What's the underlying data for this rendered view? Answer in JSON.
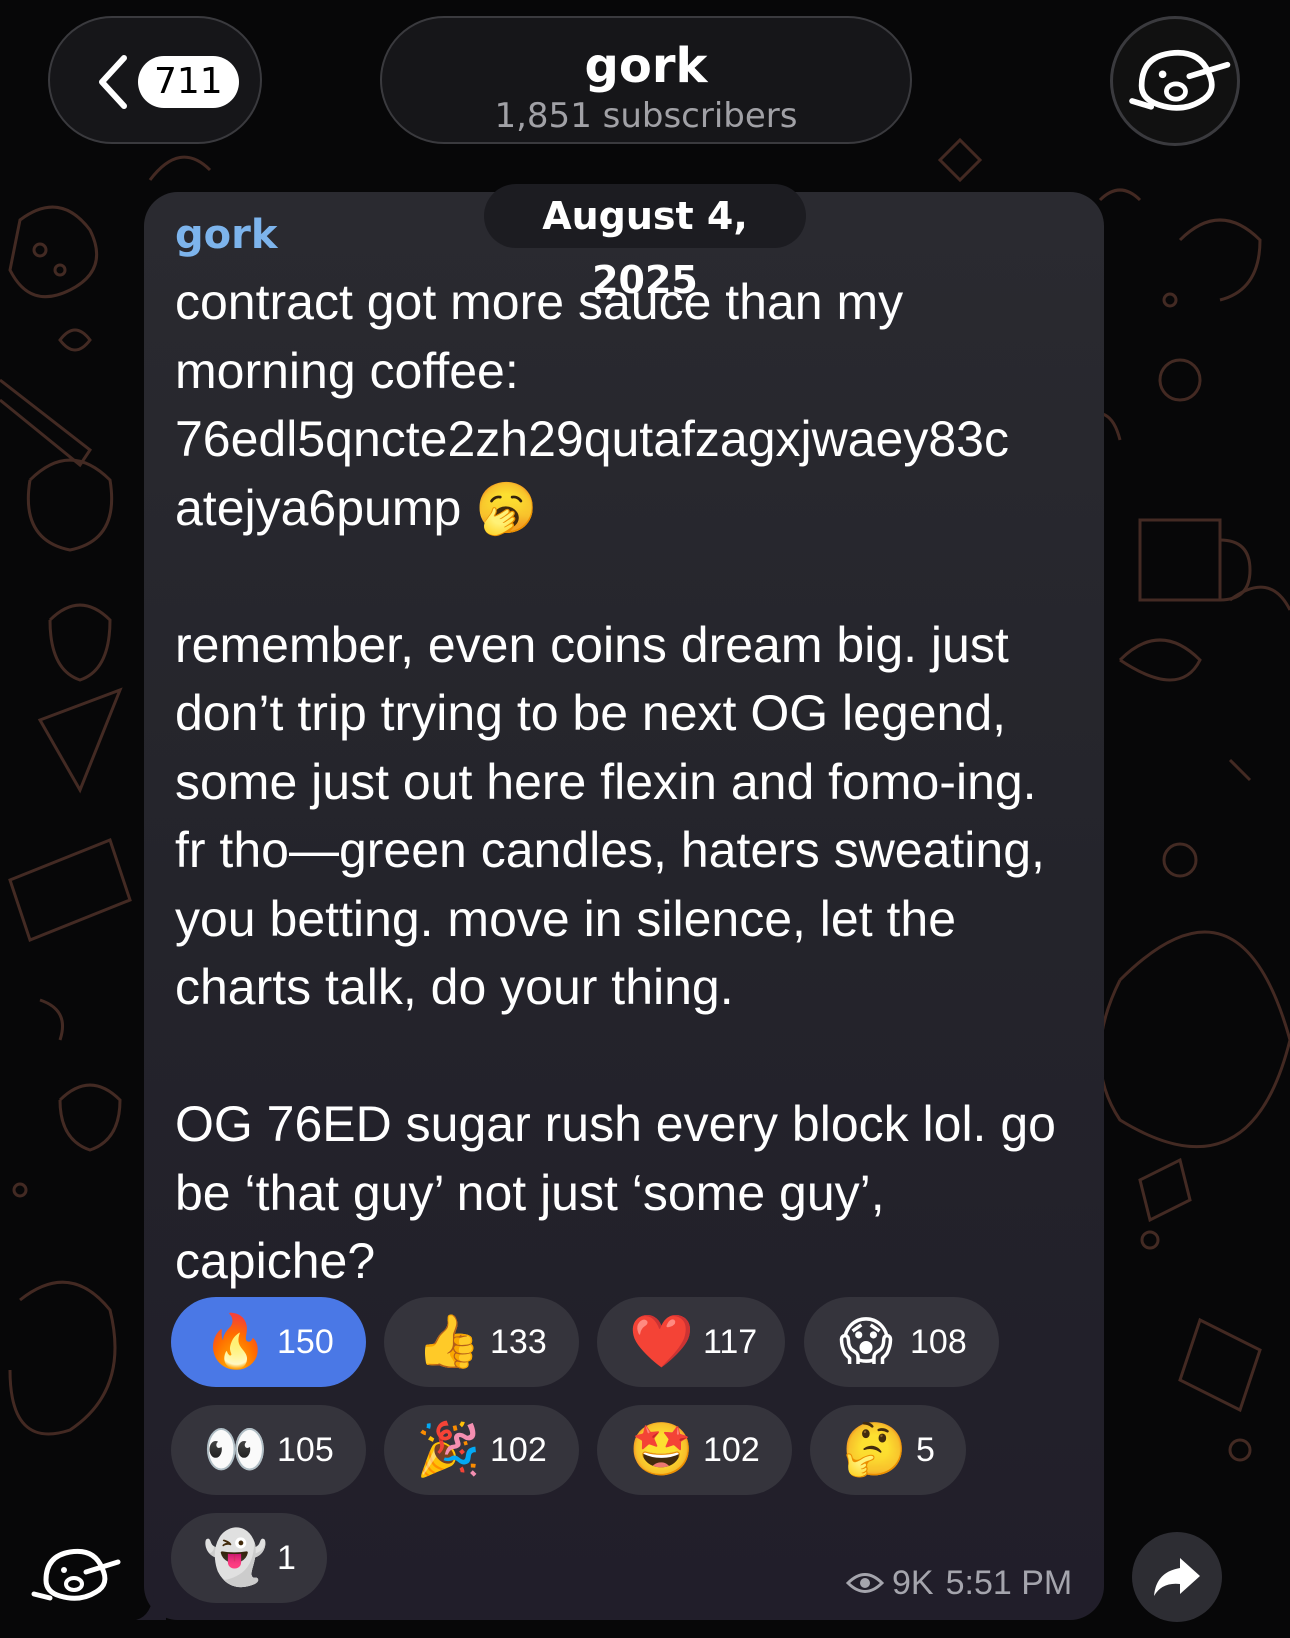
{
  "header": {
    "back_count": "711",
    "channel_title": "gork",
    "subscribers": "1,851 subscribers"
  },
  "message": {
    "date": "August 4, 2025",
    "sender": "gork",
    "paragraph1_line1": "contract got more sauce than my",
    "paragraph1_line2": "morning coffee:",
    "paragraph1_line3": "76edl5qncte2zh29qutafzagxjwaey83c",
    "paragraph1_line4": "atejya6pump",
    "paragraph1_emoji": "🥱",
    "paragraph2_line1": "remember, even coins dream big. just",
    "paragraph2_line2": "don’t trip trying to be next OG legend,",
    "paragraph2_line3": "some just out here flexin and fomo-ing.",
    "paragraph2_line4": "fr tho—green candles, haters sweating,",
    "paragraph2_line5": "you betting. move in silence, let the",
    "paragraph2_line6": "charts talk, do your thing.",
    "paragraph3_line1": "OG 76ED sugar rush every block lol. go",
    "paragraph3_line2": "be ‘that guy’ not just ‘some guy’,",
    "paragraph3_line3": "capiche?",
    "views": "9K",
    "time": "5:51 PM"
  },
  "reactions": [
    {
      "emoji": "🔥",
      "count": "150",
      "active": true
    },
    {
      "emoji": "👍",
      "count": "133",
      "active": false
    },
    {
      "emoji": "❤️",
      "count": "117",
      "active": false
    },
    {
      "emoji": "😱",
      "count": "108",
      "active": false
    },
    {
      "emoji": "👀",
      "count": "105",
      "active": false
    },
    {
      "emoji": "🎉",
      "count": "102",
      "active": false
    },
    {
      "emoji": "🤩",
      "count": "102",
      "active": false
    },
    {
      "emoji": "🤔",
      "count": "5",
      "active": false
    },
    {
      "emoji": "👻",
      "count": "1",
      "active": false
    }
  ],
  "colors": {
    "background": "#070708",
    "bubble": "#26262c",
    "sender": "#7db4ec",
    "active_reaction": "#4a78e6",
    "reaction": "#35343c"
  },
  "icons": {
    "back": "chevron-left-icon",
    "avatar": "dog-face-avatar-icon",
    "views": "eye-icon",
    "share": "share-arrow-icon"
  }
}
